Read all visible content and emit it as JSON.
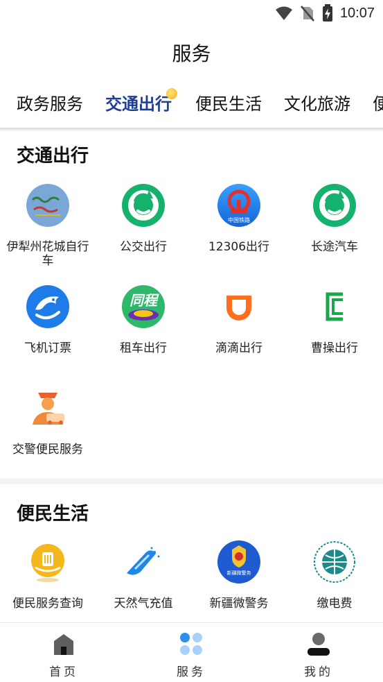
{
  "status_bar": {
    "time": "10:07",
    "icons": [
      "wifi-icon",
      "no-sim-icon",
      "battery-charging-icon"
    ]
  },
  "page_title": "服务",
  "tabs": [
    {
      "label": "政务服务",
      "active": false
    },
    {
      "label": "交通出行",
      "active": true
    },
    {
      "label": "便民生活",
      "active": false
    },
    {
      "label": "文化旅游",
      "active": false
    },
    {
      "label": "便",
      "active": false
    }
  ],
  "sections": [
    {
      "title": "交通出行",
      "items": [
        {
          "label": "伊犁州花城自行车",
          "icon": "bike-logo-icon"
        },
        {
          "label": "公交出行",
          "icon": "bus-app-icon"
        },
        {
          "label": "12306出行",
          "icon": "china-railway-icon"
        },
        {
          "label": "长途汽车",
          "icon": "coach-app-icon"
        },
        {
          "label": "飞机订票",
          "icon": "flight-dolphin-icon"
        },
        {
          "label": "租车出行",
          "icon": "tongcheng-icon"
        },
        {
          "label": "滴滴出行",
          "icon": "didi-icon"
        },
        {
          "label": "曹操出行",
          "icon": "caocao-icon"
        },
        {
          "label": "交警便民服务",
          "icon": "traffic-police-icon"
        }
      ]
    },
    {
      "title": "便民生活",
      "items": [
        {
          "label": "便民服务查询",
          "icon": "service-query-icon"
        },
        {
          "label": "天然气充值",
          "icon": "gas-recharge-icon"
        },
        {
          "label": "新疆微警务",
          "icon": "police-badge-icon",
          "badge_text": "新疆微警务"
        },
        {
          "label": "缴电费",
          "icon": "state-grid-icon"
        }
      ]
    }
  ],
  "railway_badge_text": "中国铁路",
  "tongcheng_text": "同程",
  "bottom_nav": [
    {
      "label": "首页",
      "icon": "home-icon",
      "active": false
    },
    {
      "label": "服务",
      "icon": "services-icon",
      "active": true
    },
    {
      "label": "我的",
      "icon": "profile-icon",
      "active": false
    }
  ],
  "colors": {
    "accent": "#1f3f93",
    "green": "#15b26e",
    "didi_orange": "#ff6e1f",
    "caocao_green": "#1aa64a"
  }
}
